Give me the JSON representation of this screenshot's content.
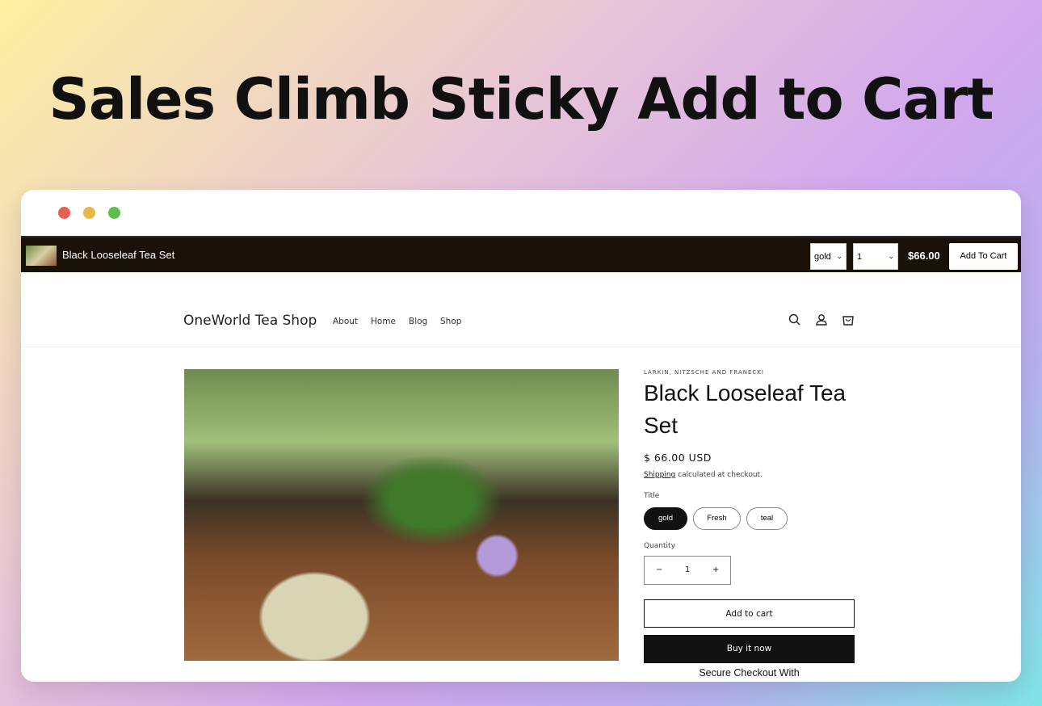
{
  "headline": "Sales Climb Sticky Add to Cart",
  "window_dots": [
    "#e5604f",
    "#eab543",
    "#5ebe4c"
  ],
  "sticky_bar": {
    "product_name": "Black Looseleaf Tea Set",
    "variant": "gold",
    "quantity": "1",
    "price": "$66.00",
    "add_to_cart": "Add To Cart"
  },
  "header": {
    "logo": "OneWorld Tea Shop",
    "nav": [
      "About",
      "Home",
      "Blog",
      "Shop"
    ]
  },
  "product": {
    "vendor": "LARKIN, NITZSCHE AND FRANECKI",
    "title": "Black Looseleaf Tea Set",
    "price": "$ 66.00 USD",
    "shipping_link": "Shipping",
    "shipping_text": " calculated at checkout.",
    "option_label": "Title",
    "options": [
      "gold",
      "Fresh",
      "teal"
    ],
    "selected_option": "gold",
    "quantity_label": "Quantity",
    "quantity": "1",
    "minus": "−",
    "plus": "+",
    "add_to_cart": "Add to cart",
    "buy_now": "Buy it now",
    "secure_checkout": "Secure Checkout With"
  }
}
